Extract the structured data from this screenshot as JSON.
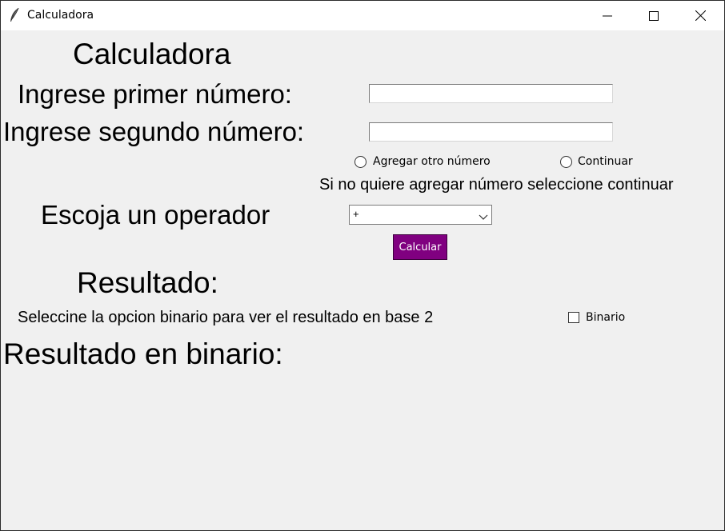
{
  "window": {
    "title": "Calculadora",
    "controls": {
      "minimize_icon": "minimize-icon",
      "maximize_icon": "maximize-icon",
      "close_icon": "close-icon"
    }
  },
  "main": {
    "heading": "Calculadora",
    "first_number_label": "Ingrese primer número:",
    "first_number_value": "",
    "second_number_label": "Ingrese segundo número:",
    "second_number_value": "",
    "radio_add_label": "Agregar otro número",
    "radio_continue_label": "Continuar",
    "hint": "Si no quiere agregar número seleccione continuar",
    "operator_label": "Escoja un operador",
    "operator_selected": "+",
    "calculate_label": "Calcular",
    "result_label": "Resultado:",
    "binary_hint": "Seleccine la opcion binario para ver el resultado en base 2",
    "binary_checkbox_label": "Binario",
    "binary_result_label": "Resultado en binario:"
  },
  "colors": {
    "background": "#f0f0f0",
    "titlebar": "#ffffff",
    "calculate_button": "#800080",
    "calculate_text": "#ffffff"
  }
}
